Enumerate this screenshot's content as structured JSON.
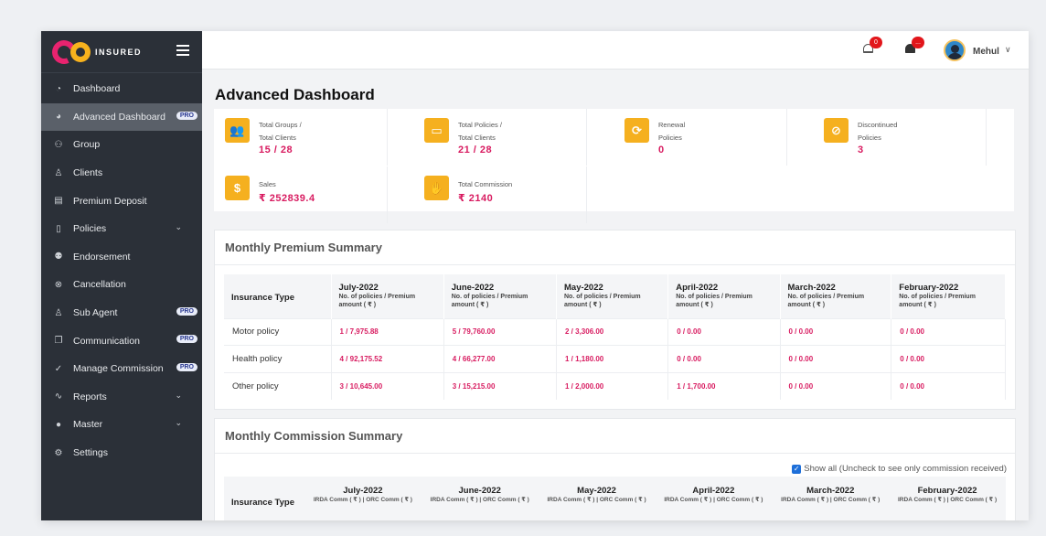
{
  "brand": {
    "logo_text": "GO",
    "name": "INSURED"
  },
  "sidebar": {
    "items": [
      {
        "label": "Dashboard",
        "icon": "gauge-icon",
        "glyph": "◔"
      },
      {
        "label": "Advanced Dashboard",
        "icon": "dashboard-icon",
        "glyph": "◕",
        "badge": "PRO"
      },
      {
        "label": "Group",
        "icon": "group-icon",
        "glyph": "⚇"
      },
      {
        "label": "Clients",
        "icon": "user-icon",
        "glyph": "♙"
      },
      {
        "label": "Premium Deposit",
        "icon": "money-icon",
        "glyph": "▤"
      },
      {
        "label": "Policies",
        "icon": "file-icon",
        "glyph": "▯",
        "chevron": "v"
      },
      {
        "label": "Endorsement",
        "icon": "users-icon",
        "glyph": "⚉"
      },
      {
        "label": "Cancellation",
        "icon": "cancel-icon",
        "glyph": "⊗"
      },
      {
        "label": "Sub Agent",
        "icon": "agent-icon",
        "glyph": "♙",
        "badge": "PRO"
      },
      {
        "label": "Communication",
        "icon": "chat-icon",
        "glyph": "❐",
        "badge": "PRO"
      },
      {
        "label": "Manage Commission",
        "icon": "check-icon",
        "glyph": "✓",
        "badge": "PRO"
      },
      {
        "label": "Reports",
        "icon": "pulse-icon",
        "glyph": "∿",
        "chevron": "v"
      },
      {
        "label": "Master",
        "icon": "master-icon",
        "glyph": "●",
        "chevron": "v"
      },
      {
        "label": "Settings",
        "icon": "gear-icon",
        "glyph": "⚙"
      }
    ]
  },
  "topbar": {
    "notifications_count": "0",
    "alerts_count": "...",
    "user_name": "Mehul"
  },
  "page_title": "Advanced Dashboard",
  "stats": [
    {
      "line1": "Total Groups /",
      "line2": "Total Clients",
      "value": "15 / 28",
      "icon": "users-icon",
      "glyph": "👥"
    },
    {
      "line1": "Total Policies /",
      "line2": "Total Clients",
      "value": "21  / 28",
      "icon": "briefcase-icon",
      "glyph": "▭"
    },
    {
      "line1": "Renewal",
      "line2": "Policies",
      "value": "0",
      "icon": "refresh-icon",
      "glyph": "⟳"
    },
    {
      "line1": "Discontinued",
      "line2": "Policies",
      "value": "3",
      "icon": "ban-icon",
      "glyph": "⊘"
    },
    {
      "line1": "Sales",
      "value": "₹ 252839.4",
      "icon": "dollar-icon",
      "glyph": "$"
    },
    {
      "line1": "Total Commission",
      "value": "₹ 2140",
      "icon": "handshake-icon",
      "glyph": "✋"
    }
  ],
  "premium_summary": {
    "title": "Monthly Premium Summary",
    "type_header": "Insurance Type",
    "sub_header": "No. of policies / Premium amount ( ₹ )",
    "months": [
      "July-2022",
      "June-2022",
      "May-2022",
      "April-2022",
      "March-2022",
      "February-2022"
    ],
    "rows": [
      {
        "type": "Motor policy",
        "values": [
          "1 / 7,975.88",
          "5 / 79,760.00",
          "2 / 3,306.00",
          "0 / 0.00",
          "0 / 0.00",
          "0 / 0.00"
        ]
      },
      {
        "type": "Health policy",
        "values": [
          "4 / 92,175.52",
          "4 / 66,277.00",
          "1 / 1,180.00",
          "0 / 0.00",
          "0 / 0.00",
          "0 / 0.00"
        ]
      },
      {
        "type": "Other policy",
        "values": [
          "3 / 10,645.00",
          "3 / 15,215.00",
          "1 / 2,000.00",
          "1 / 1,700.00",
          "0 / 0.00",
          "0 / 0.00"
        ]
      }
    ]
  },
  "commission_summary": {
    "title": "Monthly Commission Summary",
    "show_all_label": "Show all (Uncheck to see only commission received)",
    "type_header": "Insurance Type",
    "sub_header": "IRDA Comm ( ₹ ) | ORC Comm ( ₹ )",
    "months": [
      "July-2022",
      "June-2022",
      "May-2022",
      "April-2022",
      "March-2022",
      "February-2022"
    ]
  },
  "colors": {
    "accent": "#d81b60",
    "stat_icon": "#f5b01f",
    "sidebar_bg": "#2b3038"
  }
}
